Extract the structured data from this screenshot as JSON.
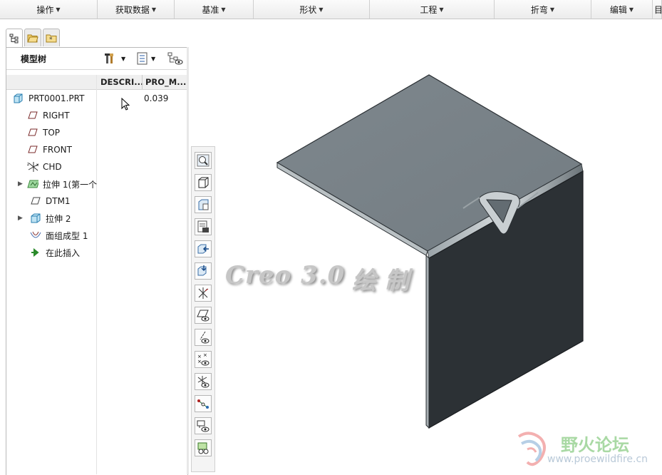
{
  "menubar": {
    "items": [
      "操作",
      "获取数据",
      "基准",
      "形状",
      "工程",
      "折弯",
      "编辑",
      "目"
    ]
  },
  "panel": {
    "title": "模型树",
    "columns": [
      "DESCRI...",
      "PRO_M..."
    ]
  },
  "tree": [
    {
      "label": "PRT0001.PRT",
      "value": "0.039",
      "icon": "part-icon",
      "expandable": false
    },
    {
      "label": "RIGHT",
      "value": "",
      "icon": "datum-plane-icon",
      "expandable": false
    },
    {
      "label": "TOP",
      "value": "",
      "icon": "datum-plane-icon",
      "expandable": false
    },
    {
      "label": "FRONT",
      "value": "",
      "icon": "datum-plane-icon",
      "expandable": false
    },
    {
      "label": "CHD",
      "value": "",
      "icon": "coordinate-system-icon",
      "expandable": false
    },
    {
      "label": "拉伸 1(第一个",
      "value": "",
      "icon": "extrude-wall-icon",
      "expandable": true
    },
    {
      "label": "DTM1",
      "value": "",
      "icon": "datum-plane-icon",
      "expandable": false
    },
    {
      "label": "拉伸 2",
      "value": "",
      "icon": "extrude-icon",
      "expandable": true
    },
    {
      "label": "面组成型 1",
      "value": "",
      "icon": "form-icon",
      "expandable": false
    },
    {
      "label": "在此插入",
      "value": "",
      "icon": "insert-here-arrow-icon",
      "expandable": false
    }
  ],
  "vertical_toolbar": [
    "zoom-icon",
    "view-box-icon",
    "view-manager-icon",
    "appearance-icon",
    "orient-in-icon",
    "orient-out-icon",
    "plane-display-icon",
    "datum-plane-display-icon",
    "axis-display-icon",
    "point-display-icon",
    "csys-display-icon",
    "spin-center-icon",
    "annotation-display-icon",
    "model-tree-display-icon"
  ],
  "watermark": {
    "text": "Creo 3.0",
    "text2": "绘 制"
  },
  "logo": {
    "text": "野火论坛",
    "url": "www.proewildfire.cn"
  },
  "colors": {
    "accent": "#3a7bc8",
    "shape_top": "#7c858b",
    "shape_side": "#2b3034"
  }
}
